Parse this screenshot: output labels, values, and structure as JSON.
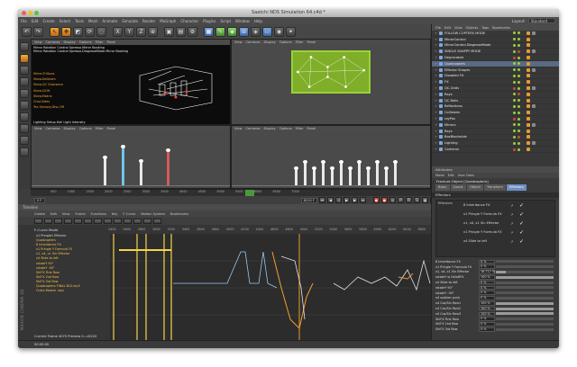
{
  "window": {
    "title": "Saatchi NDS Simulation 64.c4d *"
  },
  "menu": [
    "File",
    "Edit",
    "Create",
    "Select",
    "Tools",
    "Mesh",
    "Animate",
    "Simulate",
    "Render",
    "MoGraph",
    "Character",
    "Plugins",
    "Script",
    "Window",
    "Help"
  ],
  "layout": {
    "label": "Layout:",
    "value": "Standard"
  },
  "viewports": {
    "top_left": {
      "menu": [
        "View",
        "Cameras",
        "Display",
        "Options",
        "Filter",
        "Panel"
      ],
      "label": "",
      "hud_orange": [
        "Mirror.Trillions",
        "Show.DaGeom",
        "Show.QC Clearance",
        "Show.QCW",
        "Show.Matrix",
        "Chat.Sides",
        "Tex.Sensory.Disc.Off"
      ],
      "hud_white": [
        "Mirror Rotation Control Xpresso.Mirror Booking",
        "Mirror Rotation Control Xpresso.DiagnoseMode.Mirror Booking",
        "Lighting Setup.Hall Light Intensity"
      ]
    },
    "top_right": {
      "menu": [
        "View",
        "Cameras",
        "Display",
        "Options",
        "Filter",
        "Panel"
      ],
      "label": "Top"
    },
    "bottom_left": {
      "menu": [
        "View",
        "Cameras",
        "Display",
        "Options",
        "Filter",
        "Panel"
      ],
      "label": "Left"
    },
    "bottom_right": {
      "menu": [
        "View",
        "Cameras",
        "Display",
        "Options",
        "Filter",
        "Panel"
      ],
      "label": "Front"
    }
  },
  "timeline_ruler": [
    "500",
    "1000",
    "1500",
    "2000",
    "2500",
    "3000",
    "3500",
    "4000",
    "4500",
    "5000",
    "5500",
    "6000",
    "6500",
    "7000"
  ],
  "playbar": {
    "current": "0 F",
    "end": "8220 F",
    "frame": "4070 F"
  },
  "om": {
    "menu": [
      "File",
      "Edit",
      "View",
      "Objects",
      "Tags",
      "Bookmarks"
    ],
    "items": [
      {
        "name": "FOLLOW COPTERS MODE",
        "sel": false
      },
      {
        "name": "MirrorControl",
        "sel": false
      },
      {
        "name": "MirrorControl.DiagnoseMode",
        "sel": false
      },
      {
        "name": "SINGLE SHAPPY MODE",
        "sel": false
      },
      {
        "name": "Deprecated",
        "sel": false
      },
      {
        "name": "Quadcopters",
        "sel": true
      },
      {
        "name": "Effector Shapes",
        "sel": false
      },
      {
        "name": "Disabled FX",
        "sel": false
      },
      {
        "name": "FX",
        "sel": false
      },
      {
        "name": "QC-Grids",
        "sel": false
      },
      {
        "name": "Rays",
        "sel": false
      },
      {
        "name": "QC-Rails",
        "sel": false
      },
      {
        "name": "Reflections",
        "sel": false
      },
      {
        "name": "Collisions",
        "sel": false
      },
      {
        "name": "rayPos",
        "sel": false
      },
      {
        "name": "Mirrors",
        "sel": false
      },
      {
        "name": "Rays",
        "sel": false
      },
      {
        "name": "BoxBlockslide",
        "sel": false
      },
      {
        "name": "Lighting",
        "sel": false
      },
      {
        "name": "Cameras",
        "sel": false
      }
    ]
  },
  "am": {
    "title": "Attributes",
    "menu": [
      "Mode",
      "Edit",
      "User Data"
    ],
    "object_title": "Fracture Object [Quadcopters]",
    "tabs": [
      {
        "label": "Basic",
        "active": false
      },
      {
        "label": "Coord.",
        "active": false
      },
      {
        "label": "Object",
        "active": false
      },
      {
        "label": "Transform",
        "active": false
      },
      {
        "label": "Effectors",
        "active": true
      }
    ],
    "section": "Effectors",
    "effectors_label": "Effectors",
    "effectors": [
      "8 Inheritance FX",
      "x1 Pringle Y Formula FX",
      "x1, x4, x1 Sin Effector",
      "v1 Pringle Y Formula FX",
      "x4 Slide to left"
    ],
    "params": [
      {
        "label": "8 Inheritance FX",
        "value": "0 %",
        "fill": 0
      },
      {
        "label": "x1 Pringle Y Formula FX",
        "value": "0 %",
        "fill": 0
      },
      {
        "label": "x1, x4, x1 Sin Effector",
        "value": "16.717 %",
        "fill": 0.167
      },
      {
        "label": "rotateY w FalloffFX",
        "value": "100 %",
        "fill": 1
      },
      {
        "label": "x4 Slide to left",
        "value": "0 %",
        "fill": 0
      },
      {
        "label": "rotateY 90°",
        "value": "0 %",
        "fill": 0
      },
      {
        "label": "rotateY -90°",
        "value": "0 %",
        "fill": 0
      },
      {
        "label": "x4 sudden push",
        "value": "0 %",
        "fill": 0
      },
      {
        "label": "x4 Cos/Sin Row1",
        "value": "100 %",
        "fill": 1
      },
      {
        "label": "x4 Cos/Sin Row2",
        "value": "100 %",
        "fill": 1
      },
      {
        "label": "x4 Cos/Sin Row3",
        "value": "100 %",
        "fill": 1
      },
      {
        "label": "ShiFX First Row",
        "value": "0 %",
        "fill": 0
      },
      {
        "label": "ShiFX 2nd Row",
        "value": "0 %",
        "fill": 0
      },
      {
        "label": "ShiFX 3rd Row",
        "value": "0 %",
        "fill": 0
      }
    ]
  },
  "timeline": {
    "title": "Timeline",
    "menu": [
      "Create",
      "Edit",
      "View",
      "Frame",
      "Functions",
      "Key",
      "F-Curve",
      "Motion System",
      "Bookmarks"
    ],
    "mode_label": "F-Curve Mode",
    "ruler": [
      "2400",
      "2600",
      "2800",
      "3000",
      "3200",
      "3400",
      "3600",
      "3800",
      "4000",
      "4200",
      "4400",
      "4600",
      "4800",
      "5000",
      "5200",
      "5400",
      "5600",
      "5800",
      "6000",
      "6200",
      "6400",
      "6600",
      "6800"
    ],
    "tracks": [
      {
        "name": "x1 Pringle1 Effector",
        "hi": false
      },
      {
        "name": "Quadcopters",
        "hi": true
      },
      {
        "name": "8 Inheritance FX",
        "hi": true
      },
      {
        "name": "x1 Pringle Y Formula FX",
        "hi": true
      },
      {
        "name": "x1, x4, x1 Sin Effector",
        "hi": true
      },
      {
        "name": "x4 Slide to left",
        "hi": true
      },
      {
        "name": "rotateY 90°",
        "hi": true
      },
      {
        "name": "rotateY -90°",
        "hi": true
      },
      {
        "name": "ShiFX First Row",
        "hi": true
      },
      {
        "name": "ShiFX 2nd Row",
        "hi": true
      },
      {
        "name": "ShiFX 3rd Row",
        "hi": true
      },
      {
        "name": "Quadcopters FINAL BLS.mp3",
        "hi": true
      },
      {
        "name": "Outro Master .wav",
        "hi": true
      }
    ],
    "status": "Current Frame  4070  Preview  0-->8220",
    "vertical_label": "MAXON CINEMA 4D"
  },
  "statusbar": "00:00:00"
}
